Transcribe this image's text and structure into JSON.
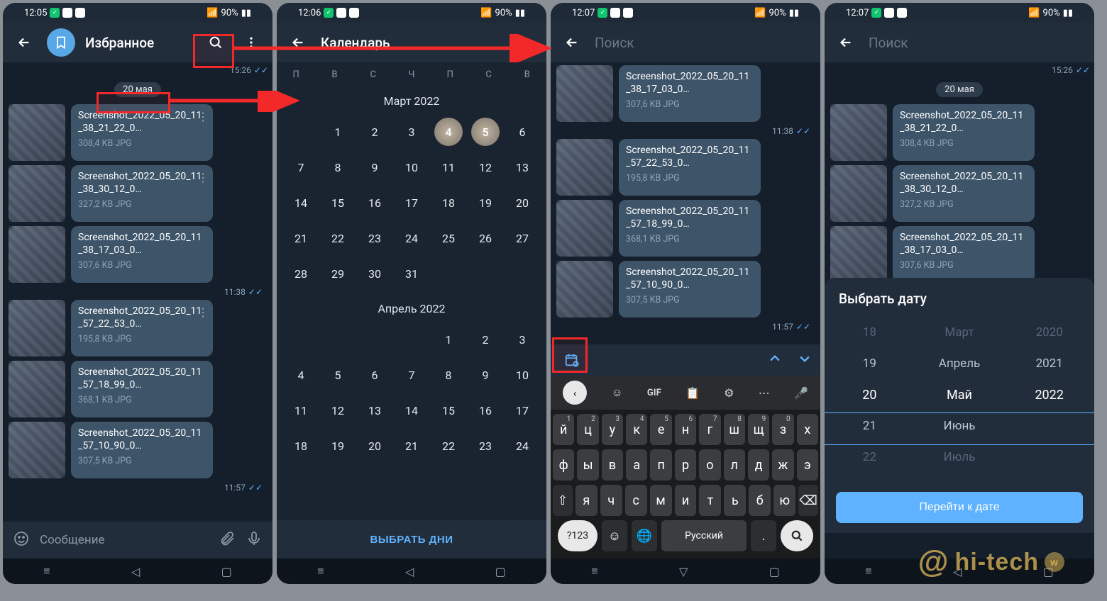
{
  "status": {
    "p1_time": "12:05",
    "p2_time": "12:06",
    "p3_time": "12:07",
    "p4_time": "12:07",
    "battery": "90%"
  },
  "phone1": {
    "title": "Избранное",
    "date_chip": "20 мая",
    "time1": "15:26",
    "time2": "11:38",
    "time3": "11:57",
    "msgs": [
      {
        "name": "Screenshot_2022_05_20_11_38_21_22_0…",
        "meta": "308,4 KB JPG"
      },
      {
        "name": "Screenshot_2022_05_20_11_38_30_12_0…",
        "meta": "327,2 KB JPG"
      },
      {
        "name": "Screenshot_2022_05_20_11_38_17_03_0…",
        "meta": "307,6 KB JPG"
      },
      {
        "name": "Screenshot_2022_05_20_11_57_22_53_0…",
        "meta": "195,8 KB JPG"
      },
      {
        "name": "Screenshot_2022_05_20_11_57_18_99_0…",
        "meta": "368,1 KB JPG"
      },
      {
        "name": "Screenshot_2022_05_20_11_57_10_90_0…",
        "meta": "307,5 KB JPG"
      }
    ],
    "compose_placeholder": "Сообщение"
  },
  "phone2": {
    "title": "Календарь",
    "weekdays": [
      "П",
      "В",
      "С",
      "Ч",
      "П",
      "С",
      "В"
    ],
    "month1": "Март 2022",
    "month2": "Апрель 2022",
    "footer": "ВЫБРАТЬ ДНИ"
  },
  "phone3": {
    "placeholder": "Поиск",
    "time1": "11:38",
    "time2": "11:57",
    "msgs": [
      {
        "name": "Screenshot_2022_05_20_11_38_17_03_0…",
        "meta": "307,6 KB JPG"
      },
      {
        "name": "Screenshot_2022_05_20_11_57_22_53_0…",
        "meta": "195,8 KB JPG"
      },
      {
        "name": "Screenshot_2022_05_20_11_57_18_99_0…",
        "meta": "368,1 KB JPG"
      },
      {
        "name": "Screenshot_2022_05_20_11_57_10_90_0…",
        "meta": "307,5 KB JPG"
      }
    ],
    "kbd_gif": "GIF",
    "kbd_row1": [
      "й",
      "ц",
      "у",
      "к",
      "е",
      "н",
      "г",
      "ш",
      "щ",
      "з",
      "х"
    ],
    "kbd_row1_sup": [
      "1",
      "2",
      "3",
      "4",
      "5",
      "6",
      "7",
      "8",
      "9",
      "0",
      ""
    ],
    "kbd_row2": [
      "ф",
      "ы",
      "в",
      "а",
      "п",
      "р",
      "о",
      "л",
      "д",
      "ж",
      "э"
    ],
    "kbd_row3": [
      "я",
      "ч",
      "с",
      "м",
      "и",
      "т",
      "ь",
      "б",
      "ю"
    ],
    "kbd_lang": "Русский",
    "kbd_sym": "?123"
  },
  "phone4": {
    "placeholder": "Поиск",
    "time1": "15:26",
    "date_chip": "20 мая",
    "msgs": [
      {
        "name": "Screenshot_2022_05_20_11_38_21_22_0…",
        "meta": "308,4 KB JPG"
      },
      {
        "name": "Screenshot_2022_05_20_11_38_30_12_0…",
        "meta": "327,2 KB JPG"
      },
      {
        "name": "Screenshot_2022_05_20_11_38_17_03_0…",
        "meta": "307,6 KB JPG"
      }
    ],
    "picker": {
      "title": "Выбрать дату",
      "days": [
        "18",
        "19",
        "20",
        "21",
        "22"
      ],
      "months": [
        "Март",
        "Апрель",
        "Май",
        "Июнь",
        "Июль"
      ],
      "years": [
        "2020",
        "2021",
        "2022",
        "",
        ""
      ],
      "button": "Перейти к дате"
    }
  },
  "watermark": "hi-tech"
}
